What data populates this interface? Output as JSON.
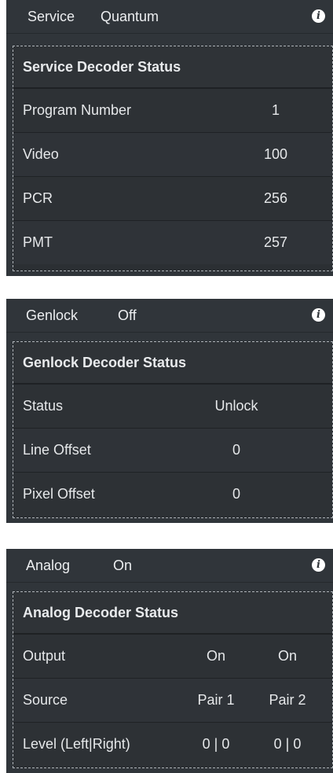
{
  "service": {
    "header_label": "Service",
    "header_value": "Quantum",
    "table_title": "Service Decoder Status",
    "rows": [
      {
        "label": "Program Number",
        "value": "1"
      },
      {
        "label": "Video",
        "value": "100"
      },
      {
        "label": "PCR",
        "value": "256"
      },
      {
        "label": "PMT",
        "value": "257"
      }
    ]
  },
  "genlock": {
    "header_label": "Genlock",
    "header_value": "Off",
    "table_title": "Genlock Decoder Status",
    "rows": [
      {
        "label": "Status",
        "value": "Unlock"
      },
      {
        "label": "Line Offset",
        "value": "0"
      },
      {
        "label": "Pixel Offset",
        "value": "0"
      }
    ]
  },
  "analog": {
    "header_label": "Analog",
    "header_value": "On",
    "table_title": "Analog Decoder Status",
    "rows": [
      {
        "label": "Output",
        "value1": "On",
        "value2": "On"
      },
      {
        "label": "Source",
        "value1": "Pair 1",
        "value2": "Pair 2"
      },
      {
        "label": "Level (Left|Right)",
        "value1": "0 | 0",
        "value2": "0 | 0"
      }
    ]
  },
  "icons": {
    "info": "info-icon"
  },
  "colors": {
    "panel_bg": "#30353a",
    "row_bg": "#2d3135",
    "text": "#e6e8ea"
  }
}
